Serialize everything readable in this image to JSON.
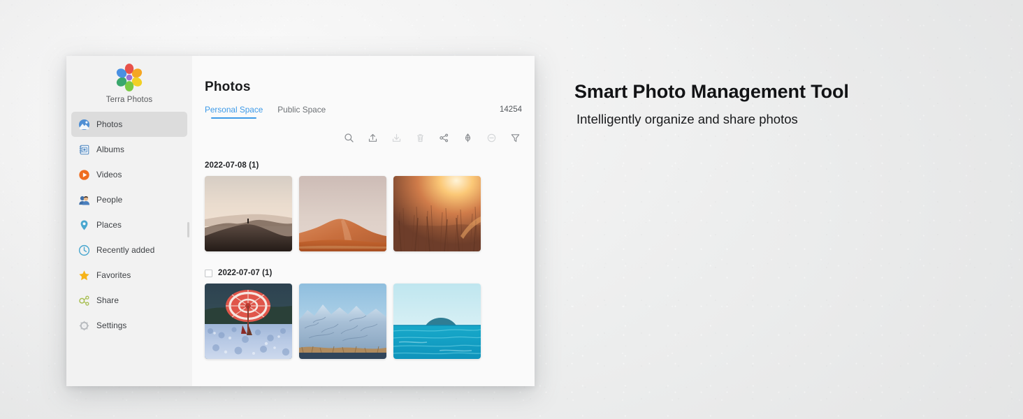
{
  "promo": {
    "title": "Smart Photo Management Tool",
    "subtitle": "Intelligently organize and share photos"
  },
  "app": {
    "brand": {
      "name": "Terra Photos",
      "logo_icon": "flower-logo-icon",
      "logo_colors": [
        "#e8524a",
        "#f5a623",
        "#f2d024",
        "#7ac943",
        "#3aa76d",
        "#4a90e2",
        "#9b6fd4"
      ]
    },
    "sidebar": {
      "items": [
        {
          "label": "Photos",
          "icon": "photos-icon",
          "active": true
        },
        {
          "label": "Albums",
          "icon": "albums-icon",
          "active": false
        },
        {
          "label": "Videos",
          "icon": "videos-icon",
          "active": false
        },
        {
          "label": "People",
          "icon": "people-icon",
          "active": false
        },
        {
          "label": "Places",
          "icon": "places-pin-icon",
          "active": false
        },
        {
          "label": "Recently added",
          "icon": "clock-icon",
          "active": false
        },
        {
          "label": "Favorites",
          "icon": "star-icon",
          "active": false
        },
        {
          "label": "Share",
          "icon": "share-nodes-icon",
          "active": false
        },
        {
          "label": "Settings",
          "icon": "gear-icon",
          "active": false
        }
      ]
    },
    "main": {
      "title": "Photos",
      "tabs": [
        {
          "label": "Personal Space",
          "active": true
        },
        {
          "label": "Public Space",
          "active": false
        }
      ],
      "count": "14254",
      "accent_color": "#3d9ae8",
      "toolbar": [
        {
          "name": "search-icon",
          "enabled": true
        },
        {
          "name": "upload-icon",
          "enabled": true
        },
        {
          "name": "download-icon",
          "enabled": false
        },
        {
          "name": "trash-icon",
          "enabled": false
        },
        {
          "name": "share-icon",
          "enabled": true
        },
        {
          "name": "tag-icon",
          "enabled": true
        },
        {
          "name": "remove-icon",
          "enabled": false
        },
        {
          "name": "filter-icon",
          "enabled": true
        }
      ],
      "groups": [
        {
          "date": "2022-07-08 (1)",
          "has_checkbox": false,
          "photos": [
            {
              "alt": "desert-dune-at-dusk-with-lone-figure",
              "theme": "dune-dusk"
            },
            {
              "alt": "orange-sand-dune-under-pale-sky",
              "theme": "orange-dune"
            },
            {
              "alt": "wheat-field-at-golden-sunset",
              "theme": "wheat-sunset"
            }
          ]
        },
        {
          "date": "2022-07-07 (1)",
          "has_checkbox": true,
          "photos": [
            {
              "alt": "red-parasol-in-blue-nemophila-field",
              "theme": "parasol-flowers"
            },
            {
              "alt": "snow-covered-mountain-range",
              "theme": "snow-mountains"
            },
            {
              "alt": "turquoise-sea-with-distant-island",
              "theme": "sea-island"
            }
          ]
        }
      ]
    }
  }
}
